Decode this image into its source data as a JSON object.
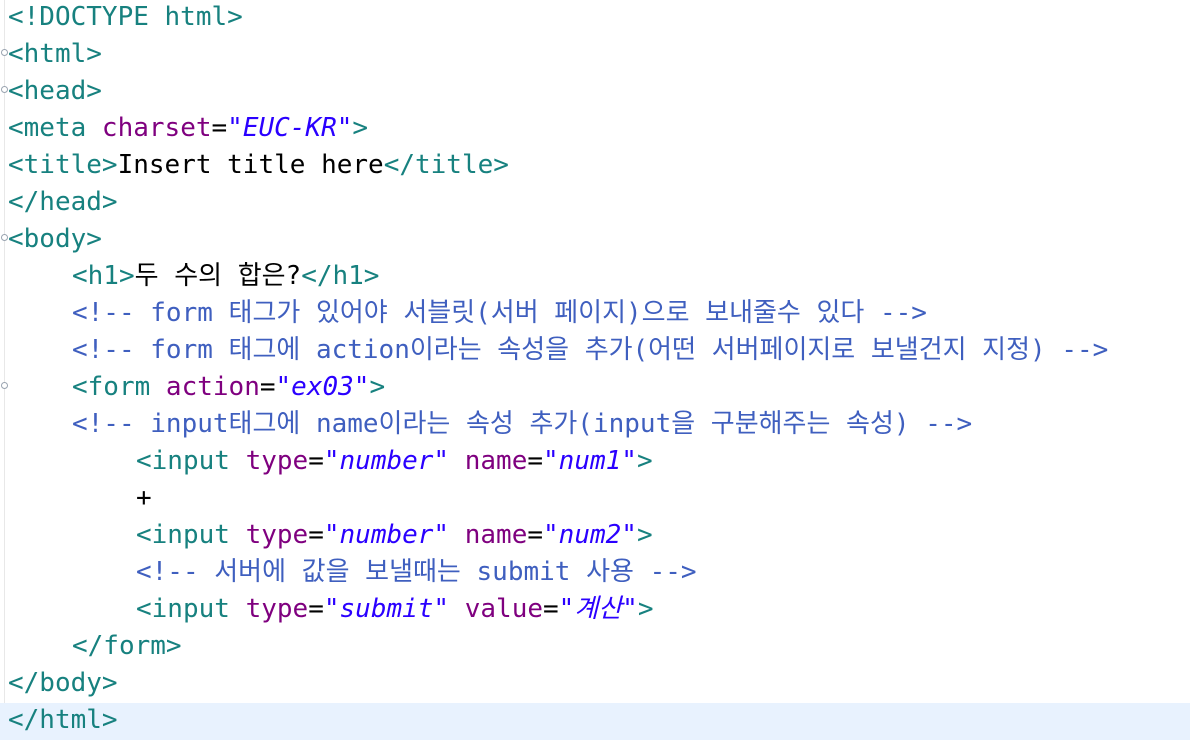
{
  "editor": {
    "lines": {
      "l1": {
        "tag": "<!DOCTYPE html>"
      },
      "l2": {
        "tag": "<html>"
      },
      "l3": {
        "tag": "<head>"
      },
      "l4": {
        "open": "<meta",
        "attr": " charset",
        "eq": "=",
        "val": "\"EUC-KR\"",
        "close": ">"
      },
      "l5": {
        "open": "<title>",
        "text": "Insert title here",
        "close": "</title>"
      },
      "l6": {
        "tag": "</head>"
      },
      "l7": {
        "tag": "<body>"
      },
      "l8": {
        "open": "<h1>",
        "text": "두 수의 합은?",
        "close": "</h1>"
      },
      "l9": {
        "comment": "<!-- form 태그가 있어야 서블릿(서버 페이지)으로 보내줄수 있다 -->"
      },
      "l10": {
        "comment": "<!-- form 태그에 action이라는 속성을 추가(어떤 서버페이지로 보낼건지 지정) -->"
      },
      "l11": {
        "open": "<form",
        "attr": " action",
        "eq": "=",
        "val": "\"ex03\"",
        "close": ">"
      },
      "l12": {
        "comment": "<!-- input태그에 name이라는 속성 추가(input을 구분해주는 속성) -->"
      },
      "l13": {
        "open": "<input",
        "attr1": " type",
        "eq1": "=",
        "val1": "\"number\"",
        "attr2": " name",
        "eq2": "=",
        "val2": "\"num1\"",
        "close": ">"
      },
      "l14": {
        "text": "+"
      },
      "l15": {
        "open": "<input",
        "attr1": " type",
        "eq1": "=",
        "val1": "\"number\"",
        "attr2": " name",
        "eq2": "=",
        "val2": "\"num2\"",
        "close": ">"
      },
      "l16": {
        "comment": "<!-- 서버에 값을 보낼때는 submit 사용 -->"
      },
      "l17": {
        "open": "<input",
        "attr1": " type",
        "eq1": "=",
        "val1": "\"submit\"",
        "attr2": " value",
        "eq2": "=",
        "val2": "\"계산\"",
        "close": ">"
      },
      "l18": {
        "tag": "</form>"
      },
      "l19": {
        "tag": "</body>"
      },
      "l20": {
        "tag": "</html>"
      }
    }
  }
}
